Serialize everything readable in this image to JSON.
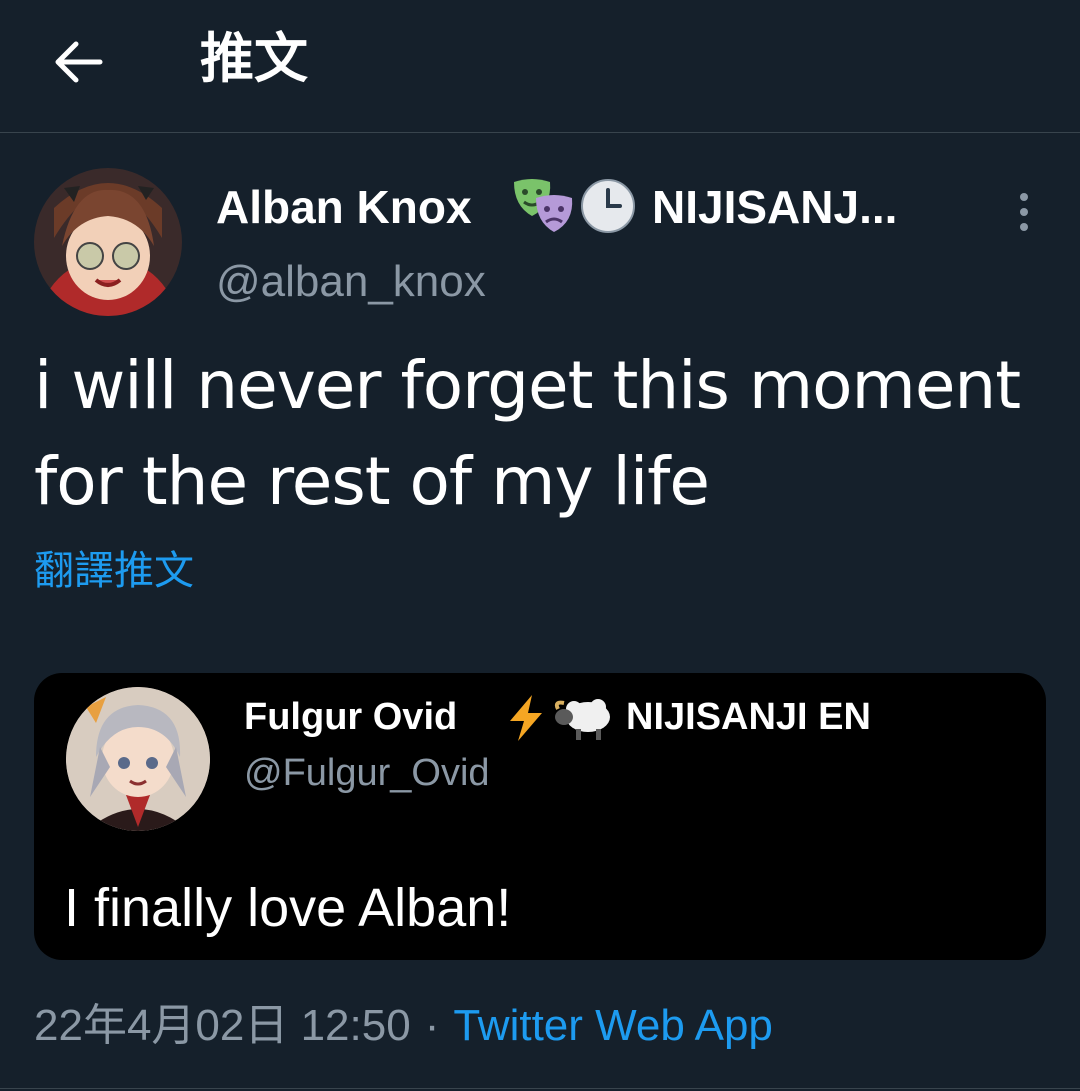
{
  "header": {
    "title": "推文",
    "back_icon": "arrow-left-icon"
  },
  "tweet": {
    "author": {
      "name": "Alban Knox",
      "emojis": [
        "performing-arts-emoji",
        "clock-emoji"
      ],
      "org": "NIJISANJ...",
      "handle": "@alban_knox"
    },
    "text": "i will never forget this moment\nfor the rest of my life",
    "translate_label": "翻譯推文",
    "quote": {
      "author": {
        "name": "Fulgur Ovid",
        "emojis": [
          "lightning-emoji",
          "sheep-emoji"
        ],
        "org": "NIJISANJI EN",
        "handle": "@Fulgur_Ovid"
      },
      "text": "I finally love Alban!"
    },
    "timestamp": "22年4月02日 12:50",
    "separator": "·",
    "client": "Twitter Web App"
  },
  "colors": {
    "background": "#15202b",
    "link": "#1d9bf0",
    "secondary_text": "#8b98a5",
    "quote_background": "#000000"
  }
}
